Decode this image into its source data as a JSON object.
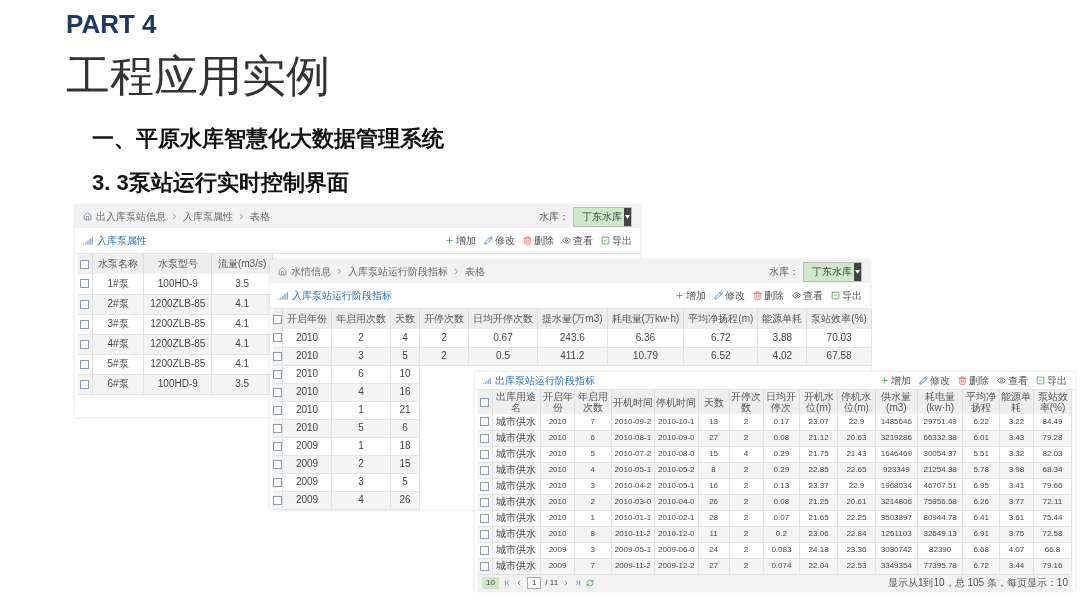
{
  "slide": {
    "part": "PART 4",
    "title": "工程应用实例",
    "heading": "一、平原水库智慧化大数据管理系统",
    "subheading": "3. 3泵站运行实时控制界面"
  },
  "panels": [
    {
      "breadcrumb": [
        "出入库泵站信息",
        "入库泵属性",
        "表格"
      ],
      "reservoir_label": "水库：",
      "reservoir": "丁东水库",
      "title": "入库泵属性",
      "toolbar": [
        {
          "kind": "add",
          "label": "增加"
        },
        {
          "kind": "edit",
          "label": "修改"
        },
        {
          "kind": "delete",
          "label": "删除"
        },
        {
          "kind": "view",
          "label": "查看"
        },
        {
          "kind": "export",
          "label": "导出"
        }
      ],
      "header_checked": false,
      "columns": [
        "水泵名称",
        "水泵型号",
        "流量(m3/s)"
      ],
      "rows": [
        {
          "checked": false,
          "cells": [
            "1#泵",
            "100HD-9",
            "3.5"
          ]
        },
        {
          "checked": false,
          "cells": [
            "2#泵",
            "1200ZLB-85",
            "4.1"
          ]
        },
        {
          "checked": false,
          "cells": [
            "3#泵",
            "1200ZLB-85",
            "4.1"
          ]
        },
        {
          "checked": false,
          "cells": [
            "4#泵",
            "1200ZLB-85",
            "4.1"
          ]
        },
        {
          "checked": false,
          "cells": [
            "5#泵",
            "1200ZLB-85",
            "4.1"
          ]
        },
        {
          "checked": false,
          "cells": [
            "6#泵",
            "100HD-9",
            "3.5"
          ]
        }
      ]
    },
    {
      "breadcrumb": [
        "水情信息",
        "入库泵站运行阶段指标",
        "表格"
      ],
      "reservoir_label": "水库：",
      "reservoir": "丁东水库",
      "title": "入库泵站运行阶段指标",
      "toolbar": [
        {
          "kind": "add",
          "label": "增加"
        },
        {
          "kind": "edit",
          "label": "修改"
        },
        {
          "kind": "delete",
          "label": "删除"
        },
        {
          "kind": "view",
          "label": "查看"
        },
        {
          "kind": "export",
          "label": "导出"
        }
      ],
      "header_checked": false,
      "columns": [
        "开启年份",
        "年启用次数",
        "天数",
        "开停次数",
        "日均开停次数",
        "提水量(万m3)",
        "耗电量(万kw·h)",
        "平均净扬程(m)",
        "能源单耗",
        "泵站效率(%)"
      ],
      "rows": [
        {
          "checked": false,
          "cells": [
            "2010",
            "2",
            "4",
            "2",
            "0.67",
            "243.6",
            "6.36",
            "6.72",
            "3.88",
            "70.03"
          ]
        },
        {
          "checked": false,
          "cells": [
            "2010",
            "3",
            "5",
            "2",
            "0.5",
            "411.2",
            "10.79",
            "6.52",
            "4.02",
            "67.58"
          ]
        },
        {
          "checked": false,
          "cells": [
            "2010",
            "6",
            "10"
          ]
        },
        {
          "checked": false,
          "cells": [
            "2010",
            "4",
            "16"
          ]
        },
        {
          "checked": false,
          "cells": [
            "2010",
            "1",
            "21"
          ]
        },
        {
          "checked": false,
          "cells": [
            "2010",
            "5",
            "6"
          ]
        },
        {
          "checked": false,
          "cells": [
            "2009",
            "1",
            "18"
          ]
        },
        {
          "checked": false,
          "cells": [
            "2009",
            "2",
            "15"
          ]
        },
        {
          "checked": false,
          "cells": [
            "2009",
            "3",
            "5"
          ]
        },
        {
          "checked": false,
          "cells": [
            "2009",
            "4",
            "26"
          ]
        }
      ]
    },
    {
      "title": "出库泵站运行阶段指标",
      "toolbar": [
        {
          "kind": "add",
          "label": "增加"
        },
        {
          "kind": "edit",
          "label": "修改"
        },
        {
          "kind": "delete",
          "label": "删除"
        },
        {
          "kind": "view",
          "label": "查看"
        },
        {
          "kind": "export",
          "label": "导出"
        }
      ],
      "header_checked": false,
      "columns": [
        "出库用途名",
        "开启年份",
        "年启用次数",
        "开机时间",
        "停机时间",
        "天数",
        "开停次数",
        "日均开停次",
        "开机水位(m)",
        "停机水位(m)",
        "供水量(m3)",
        "耗电量(kw·h)",
        "平均净扬程",
        "能源单耗",
        "泵站效率(%)"
      ],
      "rows": [
        {
          "checked": false,
          "cells": [
            "城市供水",
            "2010",
            "7",
            "2010-09-2",
            "2010-10-1",
            "13",
            "2",
            "0.17",
            "23.07",
            "22.9",
            "1485646",
            "29751.49",
            "6.22",
            "3.22",
            "84.49"
          ]
        },
        {
          "checked": false,
          "cells": [
            "城市供水",
            "2010",
            "6",
            "2010-08-1",
            "2010-09-0",
            "27",
            "2",
            "0.08",
            "21.12",
            "20.63",
            "3219286",
            "66332.38",
            "6.01",
            "3.43",
            "79.28"
          ]
        },
        {
          "checked": false,
          "cells": [
            "城市供水",
            "2010",
            "5",
            "2010-07-2",
            "2010-08-0",
            "15",
            "4",
            "0.29",
            "21.75",
            "21.43",
            "1646469",
            "30054.37",
            "5.51",
            "3.32",
            "82.03"
          ]
        },
        {
          "checked": false,
          "cells": [
            "城市供水",
            "2010",
            "4",
            "2010-05-1",
            "2010-05-2",
            "8",
            "2",
            "0.29",
            "22.85",
            "22.65",
            "923349",
            "21254.38",
            "5.78",
            "3.98",
            "68.34"
          ]
        },
        {
          "checked": false,
          "cells": [
            "城市供水",
            "2010",
            "3",
            "2010-04-2",
            "2010-05-1",
            "16",
            "2",
            "0.13",
            "23.37",
            "22.9",
            "1968034",
            "46707.51",
            "6.95",
            "3.41",
            "79.66"
          ]
        },
        {
          "checked": false,
          "cells": [
            "城市供水",
            "2010",
            "2",
            "2010-03-0",
            "2010-04-0",
            "26",
            "2",
            "0.08",
            "21.25",
            "20.61",
            "3214806",
            "75956.58",
            "6.26",
            "3.77",
            "72.11"
          ]
        },
        {
          "checked": false,
          "cells": [
            "城市供水",
            "2010",
            "1",
            "2010-01-1",
            "2010-02-1",
            "28",
            "2",
            "0.07",
            "21.65",
            "22.25",
            "3503897",
            "80944.78",
            "6.41",
            "3.61",
            "75.44"
          ]
        },
        {
          "checked": false,
          "cells": [
            "城市供水",
            "2010",
            "8",
            "2010-11-2",
            "2010-12-0",
            "11",
            "2",
            "0.2",
            "23.06",
            "22.84",
            "1261103",
            "32649.13",
            "6.91",
            "3.75",
            "72.58"
          ]
        },
        {
          "checked": false,
          "cells": [
            "城市供水",
            "2009",
            "3",
            "2009-05-1",
            "2009-06-0",
            "24",
            "2",
            "0.083",
            "24.18",
            "23.36",
            "3030742",
            "82390",
            "6.68",
            "4.07",
            "66.8"
          ]
        },
        {
          "checked": false,
          "cells": [
            "城市供水",
            "2009",
            "7",
            "2009-11-2",
            "2009-12-2",
            "27",
            "2",
            "0.074",
            "22.04",
            "22.53",
            "3349354",
            "77395.78",
            "6.72",
            "3.44",
            "79.16"
          ]
        }
      ],
      "pager": {
        "page_size": "10",
        "page": "1",
        "total_pages": "/ 11",
        "summary": "显示从1到10，总 105 条，每页显示：10"
      }
    }
  ]
}
